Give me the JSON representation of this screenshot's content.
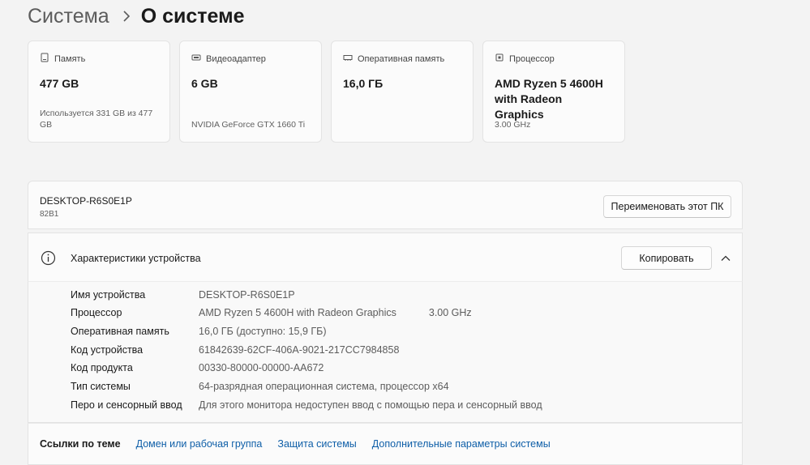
{
  "breadcrumb": {
    "parent": "Система",
    "current": "О системе"
  },
  "cards": [
    {
      "icon": "storage-icon",
      "title": "Память",
      "value": "477 GB",
      "sub": "Используется 331 GB из 477 GB"
    },
    {
      "icon": "gpu-icon",
      "title": "Видеоадаптер",
      "value": "6 GB",
      "sub": "NVIDIA GeForce GTX 1660 Ti"
    },
    {
      "icon": "ram-icon",
      "title": "Оперативная память",
      "value": "16,0 ГБ",
      "sub": ""
    },
    {
      "icon": "cpu-icon",
      "title": "Процессор",
      "value": "AMD Ryzen 5 4600H with Radeon Graphics",
      "sub": "3.00 GHz"
    }
  ],
  "device": {
    "name": "DESKTOP-R6S0E1P",
    "model": "82B1",
    "rename_label": "Переименовать этот ПК"
  },
  "specs": {
    "title": "Характеристики устройства",
    "copy_label": "Копировать",
    "rows": [
      {
        "label": "Имя устройства",
        "value": "DESKTOP-R6S0E1P",
        "extra": ""
      },
      {
        "label": "Процессор",
        "value": "AMD Ryzen 5 4600H with Radeon Graphics",
        "extra": "3.00 GHz"
      },
      {
        "label": "Оперативная память",
        "value": "16,0 ГБ (доступно: 15,9 ГБ)",
        "extra": ""
      },
      {
        "label": "Код устройства",
        "value": "61842639-62CF-406A-9021-217CC7984858",
        "extra": ""
      },
      {
        "label": "Код продукта",
        "value": "00330-80000-00000-AA672",
        "extra": ""
      },
      {
        "label": "Тип системы",
        "value": "64-разрядная операционная система, процессор x64",
        "extra": ""
      },
      {
        "label": "Перо и сенсорный ввод",
        "value": "Для этого монитора недоступен ввод с помощью пера и сенсорный ввод",
        "extra": ""
      }
    ]
  },
  "related": {
    "title": "Ссылки по теме",
    "links": [
      "Домен или рабочая группа",
      "Защита системы",
      "Дополнительные параметры системы"
    ]
  },
  "colors": {
    "background": "#f3f3f3",
    "card": "#fbfbfb",
    "link": "#0f5fa8"
  }
}
